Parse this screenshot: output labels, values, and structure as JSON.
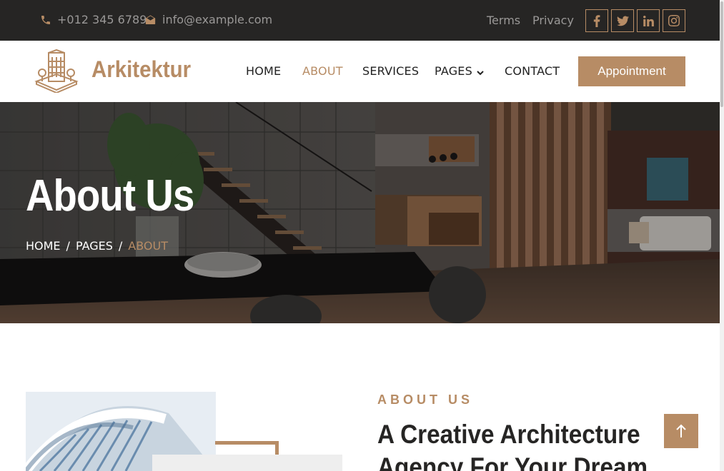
{
  "topbar": {
    "phone": "+012 345 6789",
    "email": "info@example.com",
    "links": [
      "Terms",
      "Privacy"
    ],
    "social_icons": [
      "facebook-icon",
      "twitter-icon",
      "linkedin-icon",
      "instagram-icon"
    ]
  },
  "navbar": {
    "brand": "Arkitektur",
    "links": [
      "HOME",
      "ABOUT",
      "SERVICES",
      "PAGES",
      "CONTACT"
    ],
    "active": "ABOUT",
    "cta": "Appointment"
  },
  "hero": {
    "title": "About Us",
    "breadcrumb": [
      "HOME",
      "PAGES",
      "ABOUT"
    ],
    "separator": "/"
  },
  "about": {
    "tag": "ABOUT US",
    "title_line1": "A Creative Architecture",
    "title_line2": "Agency For Your Dream"
  },
  "colors": {
    "accent": "#b78c65",
    "dark": "#262524",
    "white": "#ffffff"
  }
}
